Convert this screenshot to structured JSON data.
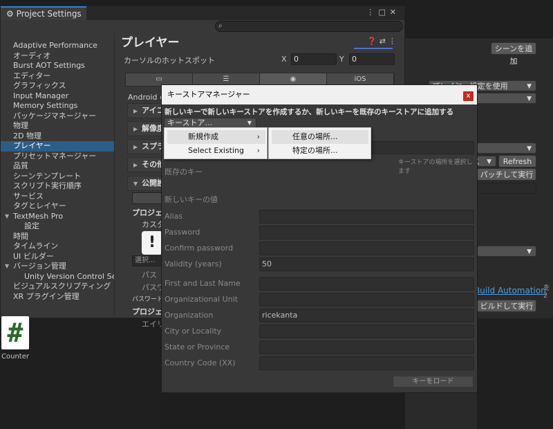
{
  "background": {
    "add_scene_button": "シーンを追加",
    "player_settings_dropdown": "プレイヤー設定を使用",
    "replace_dropdown_label": "ス",
    "refresh_button": "Refresh",
    "patch_run_button": "パッチして実行",
    "build_automation_link": "Build Automation",
    "build_run_button": "ビルドして実行",
    "right_edge_text": "を2"
  },
  "project_settings": {
    "title": "Project Settings",
    "title_icon": "gear-icon",
    "actions": [
      "⋮",
      "□",
      "✕"
    ],
    "search_placeholder": "",
    "sidebar": [
      {
        "label": "Adaptive Performance",
        "indent": 0
      },
      {
        "label": "オーディオ",
        "indent": 0
      },
      {
        "label": "Burst AOT Settings",
        "indent": 0
      },
      {
        "label": "エディター",
        "indent": 0
      },
      {
        "label": "グラフィックス",
        "indent": 0
      },
      {
        "label": "Input Manager",
        "indent": 0
      },
      {
        "label": "Memory Settings",
        "indent": 0
      },
      {
        "label": "パッケージマネージャー",
        "indent": 0
      },
      {
        "label": "物理",
        "indent": 0
      },
      {
        "label": "2D 物理",
        "indent": 0
      },
      {
        "label": "プレイヤー",
        "indent": 0,
        "selected": true
      },
      {
        "label": "プリセットマネージャー",
        "indent": 0
      },
      {
        "label": "品質",
        "indent": 0
      },
      {
        "label": "シーンテンプレート",
        "indent": 0
      },
      {
        "label": "スクリプト実行順序",
        "indent": 0
      },
      {
        "label": "サービス",
        "indent": 0
      },
      {
        "label": "タグとレイヤー",
        "indent": 0
      },
      {
        "label": "TextMesh Pro",
        "indent": 0,
        "foldout": true
      },
      {
        "label": "設定",
        "indent": 2
      },
      {
        "label": "時間",
        "indent": 0
      },
      {
        "label": "タイムライン",
        "indent": 0
      },
      {
        "label": "UI ビルダー",
        "indent": 0
      },
      {
        "label": "バージョン管理",
        "indent": 0,
        "foldout": true
      },
      {
        "label": "Unity Version Control Set",
        "indent": 2
      },
      {
        "label": "ビジュアルスクリプティング",
        "indent": 0
      },
      {
        "label": "XR プラグイン管理",
        "indent": 0
      }
    ],
    "main": {
      "heading": "プレイヤー",
      "cursor_hotspot_label": "カーソルのホットスポット",
      "hotspot_x_label": "X",
      "hotspot_x_value": "0",
      "hotspot_y_label": "Y",
      "hotspot_y_value": "0",
      "platform_tabs": [
        "monitor-icon",
        "server-icon",
        "android-icon",
        "iOS"
      ],
      "android_label": "Android の",
      "sections": [
        "アイコ",
        "解像度",
        "スプラ",
        "その他",
        "公開設"
      ],
      "project_keystore_label": "プロジェク",
      "custom_label": "カスタム",
      "select_label": "選択...",
      "path_label": "パス",
      "password_label": "パスワー",
      "password_note": "パスワードを",
      "project_key_label": "プロジェク",
      "alias_label": "エイリア"
    }
  },
  "counter_asset": {
    "icon": "#",
    "label": "Counter"
  },
  "keystore_manager": {
    "title": "キーストアマネージャー",
    "close_label": "x",
    "instruction": "新しいキーで新しいキーストアを作成するか、新しいキーを既存のキーストアに追加する",
    "keystore_dropdown": "キーストア...",
    "keystore_path_hint": "キーストアの場所を選択します",
    "existing_key_label": "既存のキー",
    "new_key_values_label": "新しいキーの値",
    "fields": [
      {
        "label": "Alias",
        "value": ""
      },
      {
        "label": "Password",
        "value": ""
      },
      {
        "label": "Confirm password",
        "value": ""
      },
      {
        "label": "Validity (years)",
        "value": "50"
      },
      {
        "label": "First and Last Name",
        "value": ""
      },
      {
        "label": "Organizational Unit",
        "value": ""
      },
      {
        "label": "Organization",
        "value": "ricekanta"
      },
      {
        "label": "City or Locality",
        "value": ""
      },
      {
        "label": "State or Province",
        "value": ""
      },
      {
        "label": "Country Code (XX)",
        "value": ""
      }
    ],
    "load_key_button": "キーをロード"
  },
  "context_menu": {
    "items": [
      {
        "label": "新規作成",
        "arrow": "›"
      },
      {
        "label": "Select Existing",
        "arrow": "›"
      }
    ],
    "submenu": [
      {
        "label": "任意の場所..."
      },
      {
        "label": "特定の場所..."
      }
    ]
  }
}
